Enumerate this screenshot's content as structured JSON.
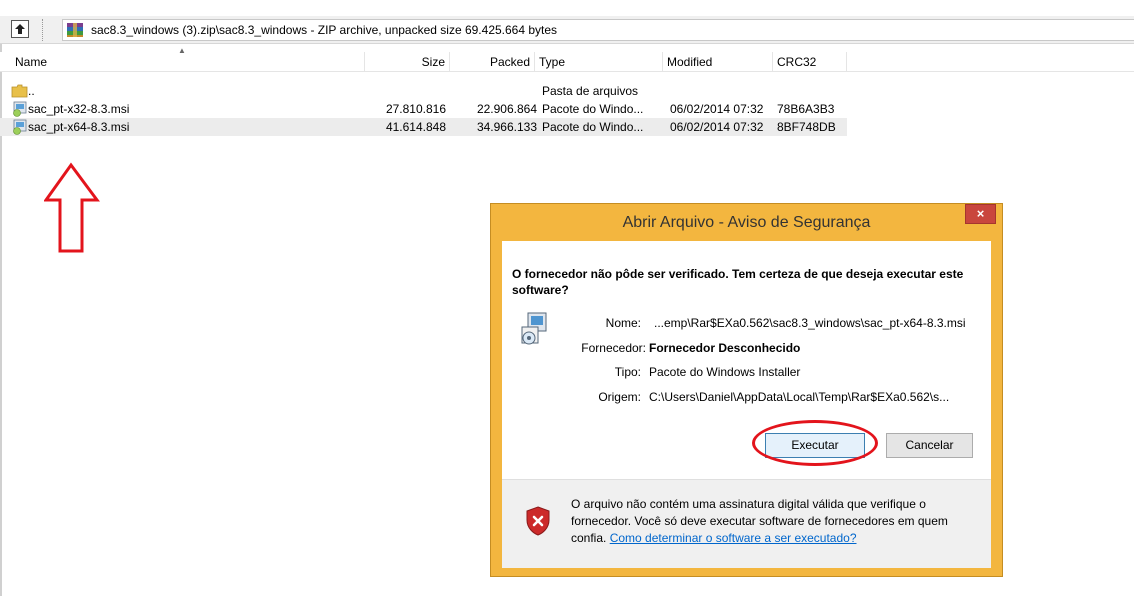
{
  "pathbar": {
    "path": "sac8.3_windows (3).zip\\sac8.3_windows - ZIP archive, unpacked size 69.425.664 bytes"
  },
  "columns": {
    "name": "Name",
    "size": "Size",
    "packed": "Packed",
    "type": "Type",
    "modified": "Modified",
    "crc": "CRC32"
  },
  "files": [
    {
      "name": "..",
      "size": "",
      "packed": "",
      "type": "Pasta de arquivos",
      "modified": "",
      "crc": ""
    },
    {
      "name": "sac_pt-x32-8.3.msi",
      "size": "27.810.816",
      "packed": "22.906.864",
      "type": "Pacote do Windo...",
      "modified": "06/02/2014 07:32",
      "crc": "78B6A3B3"
    },
    {
      "name": "sac_pt-x64-8.3.msi",
      "size": "41.614.848",
      "packed": "34.966.133",
      "type": "Pacote do Windo...",
      "modified": "06/02/2014 07:32",
      "crc": "8BF748DB"
    }
  ],
  "dialog": {
    "title": "Abrir Arquivo - Aviso de Segurança",
    "close": "×",
    "question": "O fornecedor não pôde ser verificado. Tem certeza de que deseja executar este software?",
    "fields": [
      {
        "label": "Nome:",
        "value": "...emp\\Rar$EXa0.562\\sac8.3_windows\\sac_pt-x64-8.3.msi"
      },
      {
        "label": "Fornecedor:",
        "value": "Fornecedor Desconhecido"
      },
      {
        "label": "Tipo:",
        "value": "Pacote do Windows Installer"
      },
      {
        "label": "Origem:",
        "value": "C:\\Users\\Daniel\\AppData\\Local\\Temp\\Rar$EXa0.562\\s..."
      }
    ],
    "run_button": "Executar",
    "cancel_button": "Cancelar",
    "warning_text": "O arquivo não contém uma assinatura digital válida que verifique o fornecedor. Você só deve executar software de fornecedores em quem confia.",
    "warning_link": "Como determinar o software a ser executado?"
  },
  "colors": {
    "dialog_frame": "#f3b63f",
    "annotation_red": "#e3141c",
    "link": "#0066cc"
  }
}
